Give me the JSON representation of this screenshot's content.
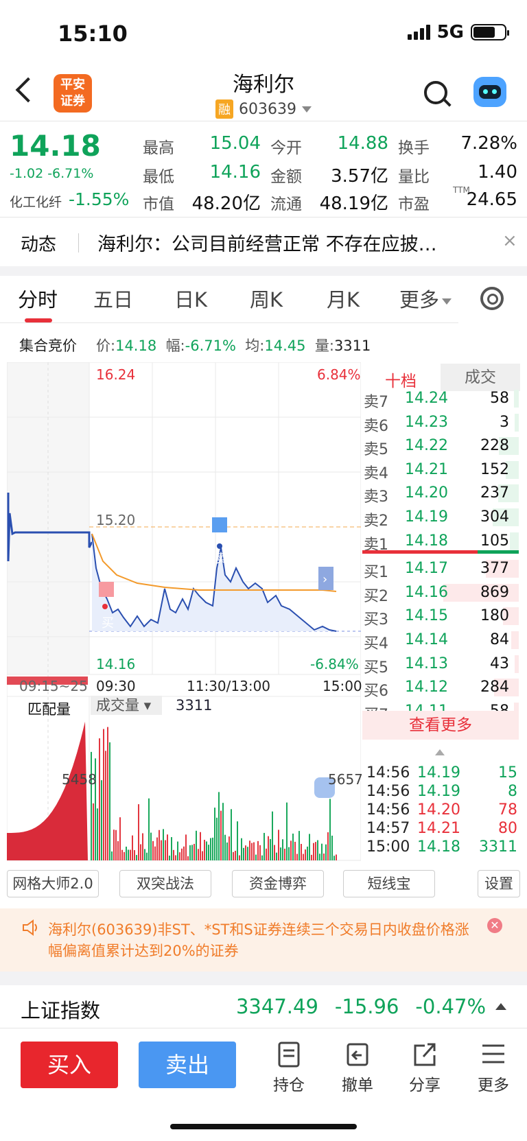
{
  "status": {
    "time": "15:10",
    "network": "5G"
  },
  "header": {
    "logo_text": "平安\n证券",
    "name": "海利尔",
    "badge": "融",
    "code": "603639"
  },
  "quote": {
    "price": "14.18",
    "change": "-1.02 -6.71%",
    "sector": "化工化纤",
    "sector_change": "-1.55%",
    "fields": [
      {
        "label": "最高",
        "value": "15.04",
        "color": "#0fa35a"
      },
      {
        "label": "今开",
        "value": "14.88",
        "color": "#0fa35a"
      },
      {
        "label": "换手",
        "value": "7.28%",
        "color": "#111"
      },
      {
        "label": "最低",
        "value": "14.16",
        "color": "#0fa35a"
      },
      {
        "label": "金额",
        "value": "3.57亿",
        "color": "#111"
      },
      {
        "label": "量比",
        "value": "1.40",
        "color": "#111"
      },
      {
        "label": "市值",
        "value": "48.20亿",
        "color": "#111"
      },
      {
        "label": "流通",
        "value": "48.19亿",
        "color": "#111"
      },
      {
        "label": "市盈",
        "value": "24.65",
        "color": "#111"
      }
    ],
    "pe_suffix": "TTM"
  },
  "news": {
    "label": "动态",
    "text": "海利尔：公司目前经营正常 不存在应披…",
    "close": "×"
  },
  "tabs": [
    "分时",
    "五日",
    "日K",
    "周K",
    "月K",
    "更多"
  ],
  "auction": {
    "label": "集合竞价",
    "price_label": "价:",
    "price": "14.18",
    "amp_label": "幅:",
    "amp": "-6.71%",
    "avg_label": "均:",
    "avg": "14.45",
    "vol_label": "量:",
    "vol": "3311"
  },
  "chart": {
    "price_high": "16.24",
    "pct_high": "6.84%",
    "price_mid": "15.20",
    "price_low": "14.16",
    "pct_low": "-6.84%",
    "time_pre": "09:15~25",
    "time_open": "09:30",
    "time_mid": "11:30/13:00",
    "time_close": "15:00",
    "buy_mark": "买",
    "sell_mark": "卖",
    "match_label": "匹配量",
    "vol_label": "成交量",
    "vol_value": "3311",
    "vol_left": "5458",
    "vol_right": "5657"
  },
  "orderbook": {
    "tab_ten": "十档",
    "tab_trade": "成交",
    "asks": [
      {
        "side": "卖7",
        "price": "14.24",
        "vol": "58"
      },
      {
        "side": "卖6",
        "price": "14.23",
        "vol": "3"
      },
      {
        "side": "卖5",
        "price": "14.22",
        "vol": "228"
      },
      {
        "side": "卖4",
        "price": "14.21",
        "vol": "152"
      },
      {
        "side": "卖3",
        "price": "14.20",
        "vol": "237"
      },
      {
        "side": "卖2",
        "price": "14.19",
        "vol": "304"
      },
      {
        "side": "卖1",
        "price": "14.18",
        "vol": "105"
      }
    ],
    "bids": [
      {
        "side": "买1",
        "price": "14.17",
        "vol": "377"
      },
      {
        "side": "买2",
        "price": "14.16",
        "vol": "869"
      },
      {
        "side": "买3",
        "price": "14.15",
        "vol": "180"
      },
      {
        "side": "买4",
        "price": "14.14",
        "vol": "84"
      },
      {
        "side": "买5",
        "price": "14.13",
        "vol": "43"
      },
      {
        "side": "买6",
        "price": "14.12",
        "vol": "284"
      },
      {
        "side": "买7",
        "price": "14.11",
        "vol": "58"
      }
    ],
    "view_more": "查看更多",
    "ticks": [
      {
        "time": "14:56",
        "price": "14.19",
        "vol": "15",
        "color": "#0fa35a"
      },
      {
        "time": "14:56",
        "price": "14.19",
        "vol": "8",
        "color": "#0fa35a"
      },
      {
        "time": "14:56",
        "price": "14.20",
        "vol": "78",
        "color": "#e8303a"
      },
      {
        "time": "14:57",
        "price": "14.21",
        "vol": "80",
        "color": "#e8303a"
      },
      {
        "time": "15:00",
        "price": "14.18",
        "vol": "3311",
        "color": "#0fa35a"
      }
    ]
  },
  "tools": [
    "网格大师2.0",
    "双突战法",
    "资金博弈",
    "短线宝",
    "设置"
  ],
  "alert": {
    "text": "海利尔(603639)非ST、*ST和S证券连续三个交易日内收盘价格涨幅偏离值累计达到20%的证券"
  },
  "index": {
    "name": "上证指数",
    "value": "3347.49",
    "change": "-15.96",
    "pct": "-0.47%"
  },
  "bottom": {
    "buy": "买入",
    "sell": "卖出",
    "items": [
      "持仓",
      "撤单",
      "分享",
      "更多"
    ]
  }
}
